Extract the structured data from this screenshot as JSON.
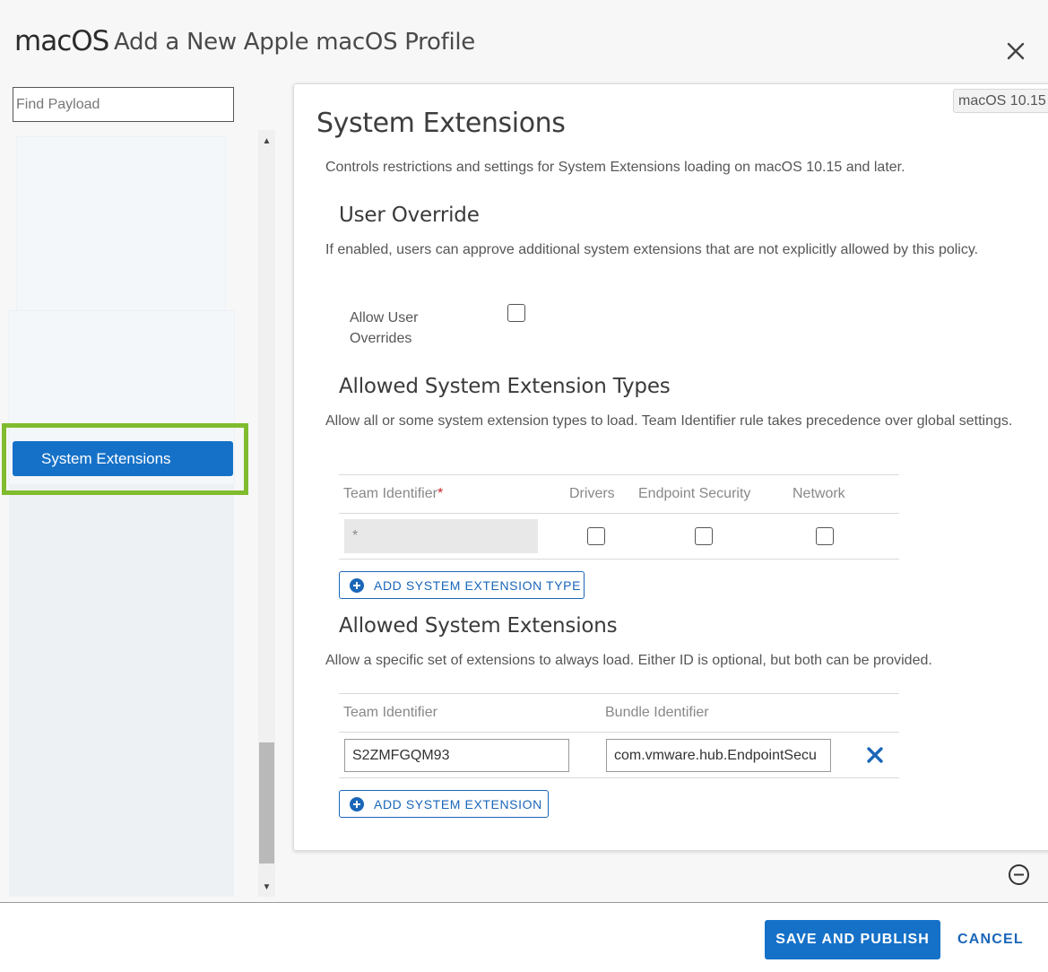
{
  "header": {
    "os_logo": "macOS",
    "title": "Add a New Apple macOS Profile"
  },
  "sidebar": {
    "search_placeholder": "Find Payload",
    "active_item": "System Extensions"
  },
  "main": {
    "version_badge": "macOS 10.15",
    "title": "System Extensions",
    "description": "Controls restrictions and settings for System Extensions loading on macOS 10.15 and later.",
    "user_override": {
      "heading": "User Override",
      "description": "If enabled, users can approve additional system extensions that are not explicitly allowed by this policy.",
      "field_label": "Allow User Overrides",
      "checked": false
    },
    "extension_types": {
      "heading": "Allowed System Extension Types",
      "description": "Allow all or some system extension types to load. Team Identifier rule takes precedence over global settings.",
      "columns": {
        "team_identifier": "Team Identifier",
        "required_marker": "*",
        "drivers": "Drivers",
        "endpoint_security": "Endpoint Security",
        "network": "Network"
      },
      "rows": [
        {
          "team_identifier": "*",
          "drivers": false,
          "endpoint_security": false,
          "network": false
        }
      ],
      "add_button": "ADD SYSTEM EXTENSION TYPE"
    },
    "extensions": {
      "heading": "Allowed System Extensions",
      "description": "Allow a specific set of extensions to always load. Either ID is optional, but both can be provided.",
      "columns": {
        "team_identifier": "Team Identifier",
        "bundle_identifier": "Bundle Identifier"
      },
      "rows": [
        {
          "team_identifier": "S2ZMFGQM93",
          "bundle_identifier": "com.vmware.hub.EndpointSecu"
        }
      ],
      "add_button": "ADD SYSTEM EXTENSION"
    }
  },
  "footer": {
    "save_label": "SAVE AND PUBLISH",
    "cancel_label": "CANCEL"
  },
  "colors": {
    "accent": "#1571c8",
    "highlight": "#80bc2e",
    "delete": "#1a66b8"
  },
  "icons": {
    "close": "close-icon",
    "plus": "plus-circle-icon",
    "delete": "x-icon",
    "collapse": "minus-circle-icon"
  }
}
